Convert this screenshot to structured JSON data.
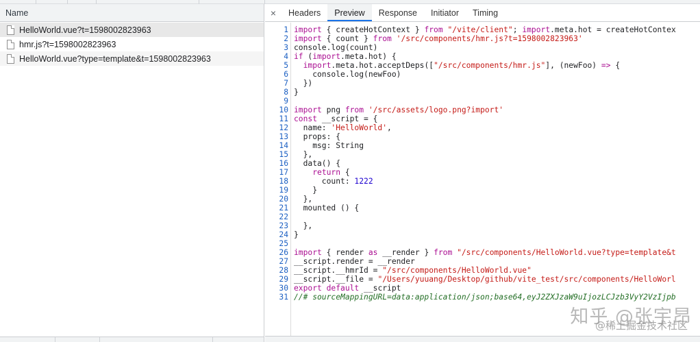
{
  "left_pane": {
    "column_header": "Name",
    "requests": [
      {
        "name": "HelloWorld.vue?t=1598002823963",
        "selected": true
      },
      {
        "name": "hmr.js?t=1598002823963",
        "selected": false
      },
      {
        "name": "HelloWorld.vue?type=template&t=1598002823963",
        "selected": false
      }
    ]
  },
  "detail_tabs": {
    "close_glyph": "×",
    "tabs": [
      "Headers",
      "Preview",
      "Response",
      "Initiator",
      "Timing"
    ],
    "active_tab": "Preview"
  },
  "source_lines": [
    [
      [
        "kw",
        "import"
      ],
      [
        "id",
        " { createHotContext } "
      ],
      [
        "kw",
        "from"
      ],
      [
        "str",
        " \"/vite/client\""
      ],
      [
        "id",
        "; "
      ],
      [
        "kw",
        "import"
      ],
      [
        "id",
        ".meta.hot = createHotContex"
      ]
    ],
    [
      [
        "kw",
        "import"
      ],
      [
        "id",
        " { count } "
      ],
      [
        "kw",
        "from"
      ],
      [
        "str",
        " '/src/components/hmr.js?t=1598002823963'"
      ]
    ],
    [
      [
        "id",
        "console.log(count)"
      ]
    ],
    [
      [
        "kw",
        "if"
      ],
      [
        "id",
        " ("
      ],
      [
        "kw",
        "import"
      ],
      [
        "id",
        ".meta.hot) {"
      ]
    ],
    [
      [
        "id",
        "  "
      ],
      [
        "kw",
        "import"
      ],
      [
        "id",
        ".meta.hot.acceptDeps(["
      ],
      [
        "str",
        "\"/src/components/hmr.js\""
      ],
      [
        "id",
        "], (newFoo) "
      ],
      [
        "kw",
        "=>"
      ],
      [
        "id",
        " {"
      ]
    ],
    [
      [
        "id",
        "    console.log(newFoo)"
      ]
    ],
    [
      [
        "id",
        "  })"
      ]
    ],
    [
      [
        "id",
        "}"
      ]
    ],
    [
      [
        "id",
        ""
      ]
    ],
    [
      [
        "kw",
        "import"
      ],
      [
        "id",
        " png "
      ],
      [
        "kw",
        "from"
      ],
      [
        "str",
        " '/src/assets/logo.png?import'"
      ]
    ],
    [
      [
        "kw",
        "const"
      ],
      [
        "id",
        " __script = {"
      ]
    ],
    [
      [
        "id",
        "  name: "
      ],
      [
        "str",
        "'HelloWorld'"
      ],
      [
        "id",
        ","
      ]
    ],
    [
      [
        "id",
        "  props: {"
      ]
    ],
    [
      [
        "id",
        "    msg: String"
      ]
    ],
    [
      [
        "id",
        "  },"
      ]
    ],
    [
      [
        "id",
        "  data() {"
      ]
    ],
    [
      [
        "id",
        "    "
      ],
      [
        "kw",
        "return"
      ],
      [
        "id",
        " {"
      ]
    ],
    [
      [
        "id",
        "      count: "
      ],
      [
        "num",
        "1222"
      ]
    ],
    [
      [
        "id",
        "    }"
      ]
    ],
    [
      [
        "id",
        "  },"
      ]
    ],
    [
      [
        "id",
        "  mounted () {"
      ]
    ],
    [
      [
        "id",
        ""
      ]
    ],
    [
      [
        "id",
        "  },"
      ]
    ],
    [
      [
        "id",
        "}"
      ]
    ],
    [
      [
        "id",
        ""
      ]
    ],
    [
      [
        "kw",
        "import"
      ],
      [
        "id",
        " { render "
      ],
      [
        "kw",
        "as"
      ],
      [
        "id",
        " __render } "
      ],
      [
        "kw",
        "from"
      ],
      [
        "str",
        " \"/src/components/HelloWorld.vue?type=template&t"
      ]
    ],
    [
      [
        "id",
        "__script.render = __render"
      ]
    ],
    [
      [
        "id",
        "__script.__hmrId = "
      ],
      [
        "str",
        "\"/src/components/HelloWorld.vue\""
      ]
    ],
    [
      [
        "id",
        "__script.__file = "
      ],
      [
        "str",
        "\"/Users/yuuang/Desktop/github/vite_test/src/components/HelloWorl"
      ]
    ],
    [
      [
        "kw",
        "export"
      ],
      [
        "id",
        " "
      ],
      [
        "kw",
        "default"
      ],
      [
        "id",
        " __script"
      ]
    ],
    [
      [
        "cm",
        "//# sourceMappingURL=data:application/json;base64,eyJ2ZXJzaW9uIjozLCJzb3VyY2VzIjpb"
      ]
    ]
  ],
  "watermark": {
    "line1": "知乎 @张宇昂",
    "line2": "@稀土掘金技术社区"
  },
  "colors": {
    "keyword": "#aa0d91",
    "string": "#c41a16",
    "number": "#1c00cf",
    "comment": "#236e25",
    "line_number": "#1b5fc2",
    "active_tab_underline": "#1a73e8"
  }
}
